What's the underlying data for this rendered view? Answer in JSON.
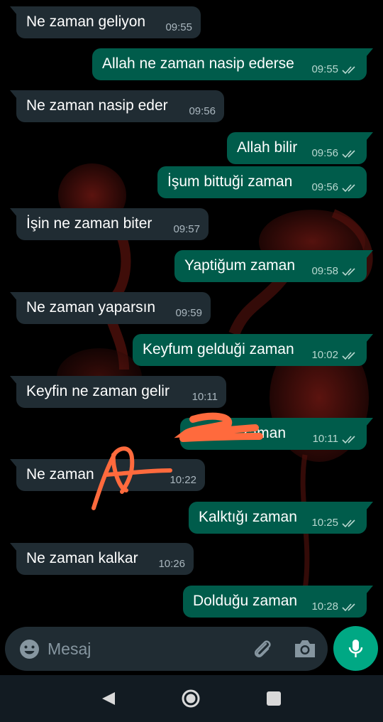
{
  "messages": [
    {
      "side": "in",
      "text": "Ne zaman geliyon",
      "time": "09:55",
      "tail": true
    },
    {
      "side": "out",
      "text": "Allah ne zaman nasip ederse",
      "time": "09:55",
      "tail": true
    },
    {
      "side": "in",
      "text": "Ne zaman nasip eder",
      "time": "09:56",
      "tail": true
    },
    {
      "side": "out",
      "text": "Allah bilir",
      "time": "09:56",
      "tail": true
    },
    {
      "side": "out",
      "text": "İşum bittuği zaman",
      "time": "09:56",
      "tail": false
    },
    {
      "side": "in",
      "text": "İşin ne zaman biter",
      "time": "09:57",
      "tail": true
    },
    {
      "side": "out",
      "text": "Yaptiğum zaman",
      "time": "09:58",
      "tail": true
    },
    {
      "side": "in",
      "text": "Ne zaman yaparsın",
      "time": "09:59",
      "tail": true
    },
    {
      "side": "out",
      "text": "Keyfum gelduği zaman",
      "time": "10:02",
      "tail": true
    },
    {
      "side": "in",
      "text": "Keyfin ne zaman gelir",
      "time": "10:11",
      "tail": true
    },
    {
      "side": "out",
      "text": "zaman",
      "time": "10:11",
      "tail": true
    },
    {
      "side": "in",
      "text": "Ne zaman",
      "time": "10:22",
      "tail": true
    },
    {
      "side": "out",
      "text": "Kalktığı zaman",
      "time": "10:25",
      "tail": true
    },
    {
      "side": "in",
      "text": "Ne zaman kalkar",
      "time": "10:26",
      "tail": true
    },
    {
      "side": "out",
      "text": "Dolduğu zaman",
      "time": "10:28",
      "tail": true
    }
  ],
  "input": {
    "placeholder": "Mesaj"
  },
  "icons": {
    "emoji": "emoji-icon",
    "attach": "paperclip-icon",
    "camera": "camera-icon",
    "mic": "mic-icon",
    "back": "back-icon",
    "home": "home-icon",
    "recents": "recents-icon",
    "read_receipt": "double-check-icon"
  },
  "colors": {
    "incoming_bubble": "#202c33",
    "outgoing_bubble": "#005c4b",
    "accent": "#00a884",
    "scribble": "#ff6a3d",
    "read_ticks": "#b8d8d0"
  }
}
